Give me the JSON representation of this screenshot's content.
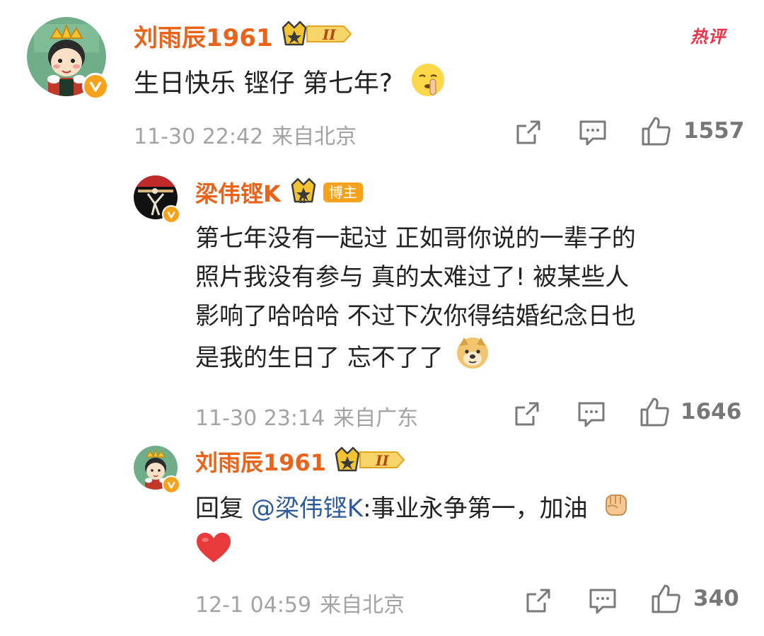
{
  "hot_label": "热评",
  "comments": [
    {
      "username": "刘雨辰1961",
      "text": "生日快乐 铿仔 第七年?",
      "date": "11-30 22:42",
      "location": "来自北京",
      "likes": "1557"
    },
    {
      "username": "梁伟铿K",
      "author_tag": "博主",
      "lines": [
        "第七年没有一起过 正如哥你说的一辈子的",
        "照片我没有参与 真的太难过了! 被某些人",
        "影响了哈哈哈 不过下次你得结婚纪念日也",
        "是我的生日了 忘不了了"
      ],
      "date": "11-30 23:14",
      "location": "来自广东",
      "likes": "1646"
    },
    {
      "username": "刘雨辰1961",
      "reply_prefix": "回复 ",
      "mention": "@梁伟铿K",
      "reply_text": ":事业永争第一，加油",
      "date": "12-1 04:59",
      "location": "来自北京",
      "likes": "340"
    }
  ],
  "colors": {
    "username": "#e9631b",
    "mention": "#2e5a99",
    "meta": "#a3a3a3",
    "badge": "#f7a21b",
    "hot": "#e8334a"
  },
  "icons": [
    "share-icon",
    "comment-icon",
    "like-icon",
    "verified-icon",
    "crown-icon"
  ]
}
